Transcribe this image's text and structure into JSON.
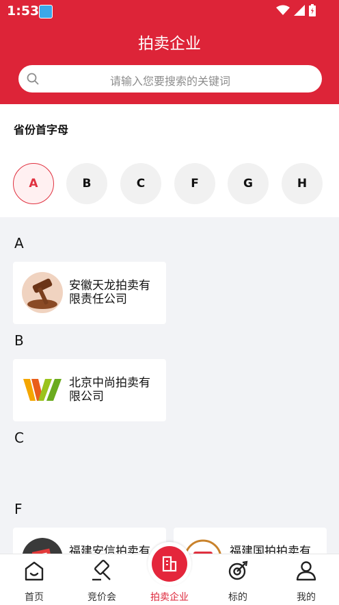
{
  "status_bar": {
    "time": "1:53"
  },
  "header": {
    "title": "拍卖企业"
  },
  "search": {
    "placeholder": "请输入您要搜索的关键词"
  },
  "filter": {
    "title": "省份首字母",
    "letters": [
      "A",
      "B",
      "C",
      "F",
      "G",
      "H"
    ],
    "selected": "A"
  },
  "sections": [
    {
      "letter": "A",
      "companies": [
        {
          "name": "安徽天龙拍卖有限责任公司"
        }
      ]
    },
    {
      "letter": "B",
      "companies": [
        {
          "name": "北京中尚拍卖有限公司"
        }
      ]
    },
    {
      "letter": "C",
      "companies": []
    },
    {
      "letter": "F",
      "companies": [
        {
          "name": "福建安信拍卖有限公司"
        },
        {
          "name": "福建国拍拍卖有限公司"
        }
      ]
    }
  ],
  "tabs": [
    {
      "label": "首页",
      "icon": "home-icon"
    },
    {
      "label": "竞价会",
      "icon": "gavel-icon"
    },
    {
      "label": "拍卖企业",
      "icon": "building-icon",
      "active": true
    },
    {
      "label": "标的",
      "icon": "target-icon"
    },
    {
      "label": "我的",
      "icon": "user-icon"
    }
  ],
  "colors": {
    "primary": "#dd2438",
    "accent": "#e0303f"
  }
}
